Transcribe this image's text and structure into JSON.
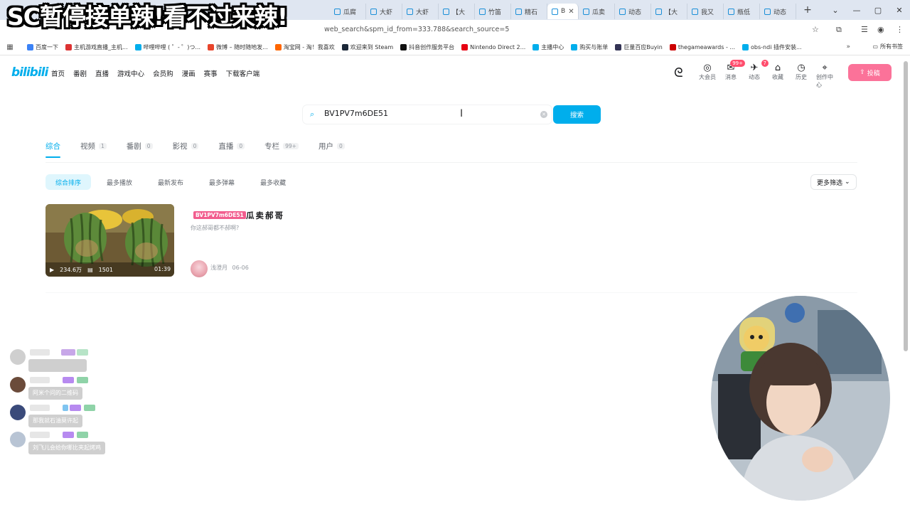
{
  "browser": {
    "tabs": [
      "瓜腐",
      "大虾",
      "大虾",
      "【大",
      "竹笛",
      "精石",
      "B",
      "瓜卖",
      "动态",
      "【大",
      "我又",
      "瓶低",
      "动态"
    ],
    "active_tab_index": 6,
    "url_suffix": "web_search&spm_id_from=333.788&search_source=5",
    "bookmarks": [
      "百度一下",
      "主机游戏直播_主机...",
      "哔哩哔哩 ( ゜- ゜)つ...",
      "微博 – 随时随地发...",
      "淘宝网 - 淘！我喜欢",
      "欢迎来到 Steam",
      "抖音创作服务平台",
      "Nintendo Direct 2...",
      "主播中心",
      "购买与账单",
      "巨量百应Buyin",
      "thegameawards - ...",
      "obs-ndi 插件安装..."
    ],
    "bookmarks_folder": "所有书签"
  },
  "bilibili": {
    "logo": "bilibili",
    "nav": [
      "首页",
      "番剧",
      "直播",
      "游戏中心",
      "会员购",
      "漫画",
      "赛事",
      "下载客户端"
    ],
    "header_right": [
      {
        "label": "大会员",
        "icon": "vip-icon"
      },
      {
        "label": "消息",
        "icon": "message-icon",
        "badge": "99+"
      },
      {
        "label": "动态",
        "icon": "dynamic-icon",
        "badge": "7"
      },
      {
        "label": "收藏",
        "icon": "favorite-icon"
      },
      {
        "label": "历史",
        "icon": "history-icon"
      },
      {
        "label": "创作中心",
        "icon": "creator-icon"
      }
    ],
    "upload_label": "投稿"
  },
  "search": {
    "query": "BV1PV7m6DE51",
    "button_label": "搜索"
  },
  "search_tabs": [
    {
      "label": "综合",
      "count": ""
    },
    {
      "label": "视频",
      "count": "1"
    },
    {
      "label": "番剧",
      "count": "0"
    },
    {
      "label": "影视",
      "count": "0"
    },
    {
      "label": "直播",
      "count": "0"
    },
    {
      "label": "专栏",
      "count": "99+"
    },
    {
      "label": "用户",
      "count": "0"
    }
  ],
  "sort_options": [
    "综合排序",
    "最多播放",
    "最新发布",
    "最多弹幕",
    "最多收藏"
  ],
  "more_filter_label": "更多筛选",
  "result": {
    "bv_tag": "BV1PV7m6DE51",
    "title": "瓜卖郝哥",
    "description": "你这郝哥都不郝啊?",
    "plays": "234.6万",
    "danmaku": "1501",
    "duration": "01:39",
    "author": "浅澄月",
    "date": "06-06"
  },
  "caption": "SC暂停接单辣!看不过来辣!",
  "danmu": [
    {
      "text": ""
    },
    {
      "text": "阿米个问的二维码"
    },
    {
      "text": "那我就石油莫许起"
    },
    {
      "text": "刘飞儿会给你哪比夹起烤鸡"
    }
  ],
  "colors": {
    "accent": "#00aeec",
    "pink": "#fb7299"
  }
}
